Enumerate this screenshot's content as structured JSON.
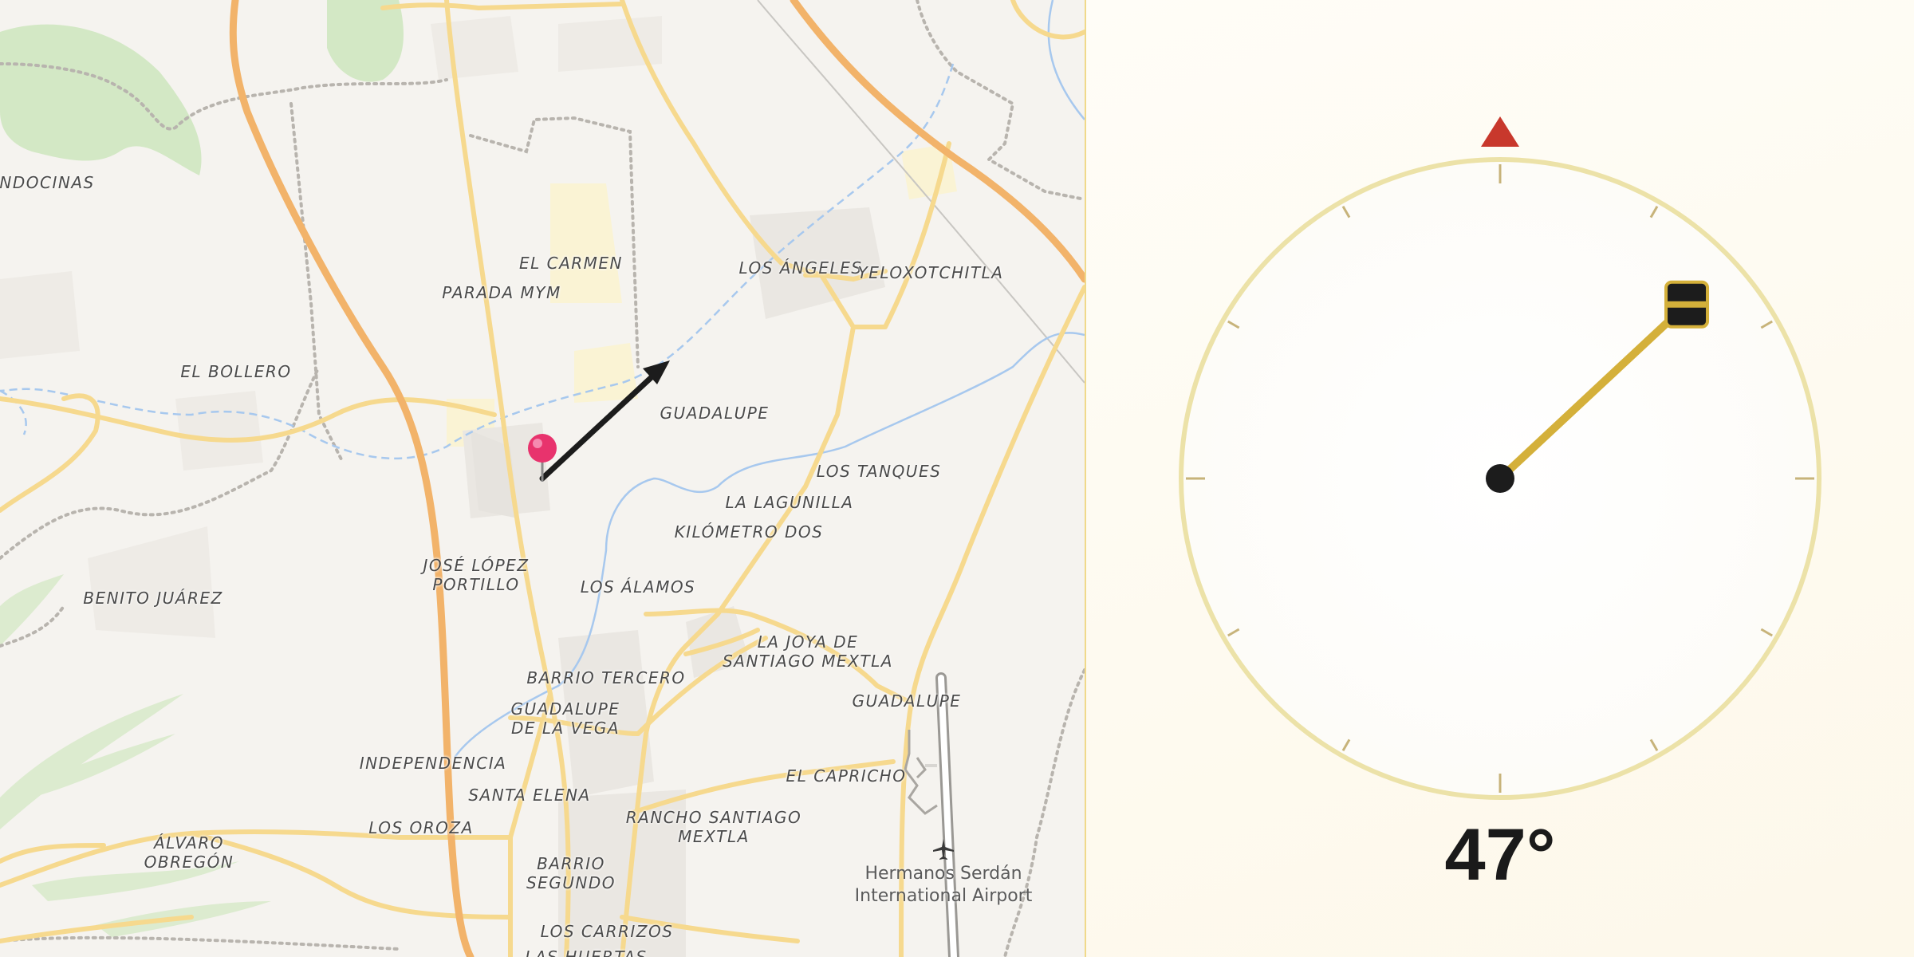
{
  "map": {
    "places": [
      {
        "name": "ENDOCINAS"
      },
      {
        "name": "EL CARMEN"
      },
      {
        "name": "PARADA MYM"
      },
      {
        "name": "LOS ÁNGELES"
      },
      {
        "name": "YELOXOTCHITLA"
      },
      {
        "name": "EL BOLLERO"
      },
      {
        "name": "GUADALUPE"
      },
      {
        "name": "LOS TANQUES"
      },
      {
        "name": "LA LAGUNILLA"
      },
      {
        "name": "KILÓMETRO DOS"
      },
      {
        "name": "JOSÉ LÓPEZ\nPORTILLO"
      },
      {
        "name": "LOS ÁLAMOS"
      },
      {
        "name": "BENITO JUÁREZ"
      },
      {
        "name": "LA JOYA DE\nSANTIAGO MEXTLA"
      },
      {
        "name": "BARRIO TERCERO"
      },
      {
        "name": "GUADALUPE\nDE LA VEGA"
      },
      {
        "name": "GUADALUPE"
      },
      {
        "name": "INDEPENDENCIA"
      },
      {
        "name": "EL CAPRICHO"
      },
      {
        "name": "SANTA ELENA"
      },
      {
        "name": "LOS OROZA"
      },
      {
        "name": "RANCHO SANTIAGO\nMEXTLA"
      },
      {
        "name": "ÁLVARO\nOBREGÓN"
      },
      {
        "name": "BARRIO\nSEGUNDO"
      },
      {
        "name": "LOS CARRIZOS"
      },
      {
        "name": "LAS HUERTAS"
      }
    ],
    "airport": {
      "name": "Hermanos Serdán\nInternational Airport",
      "icon": "airplane-icon"
    },
    "marker": {
      "icon": "map-pin-icon",
      "color": "#e8336d"
    },
    "direction_arrow": {
      "icon": "direction-arrow-icon",
      "bearing_deg": 47
    }
  },
  "compass": {
    "heading_deg": 47,
    "heading_label": "47°",
    "north_marker_color": "#c8382c",
    "needle_color": "#d4b03a",
    "ring_color": "#ece2a8"
  }
}
